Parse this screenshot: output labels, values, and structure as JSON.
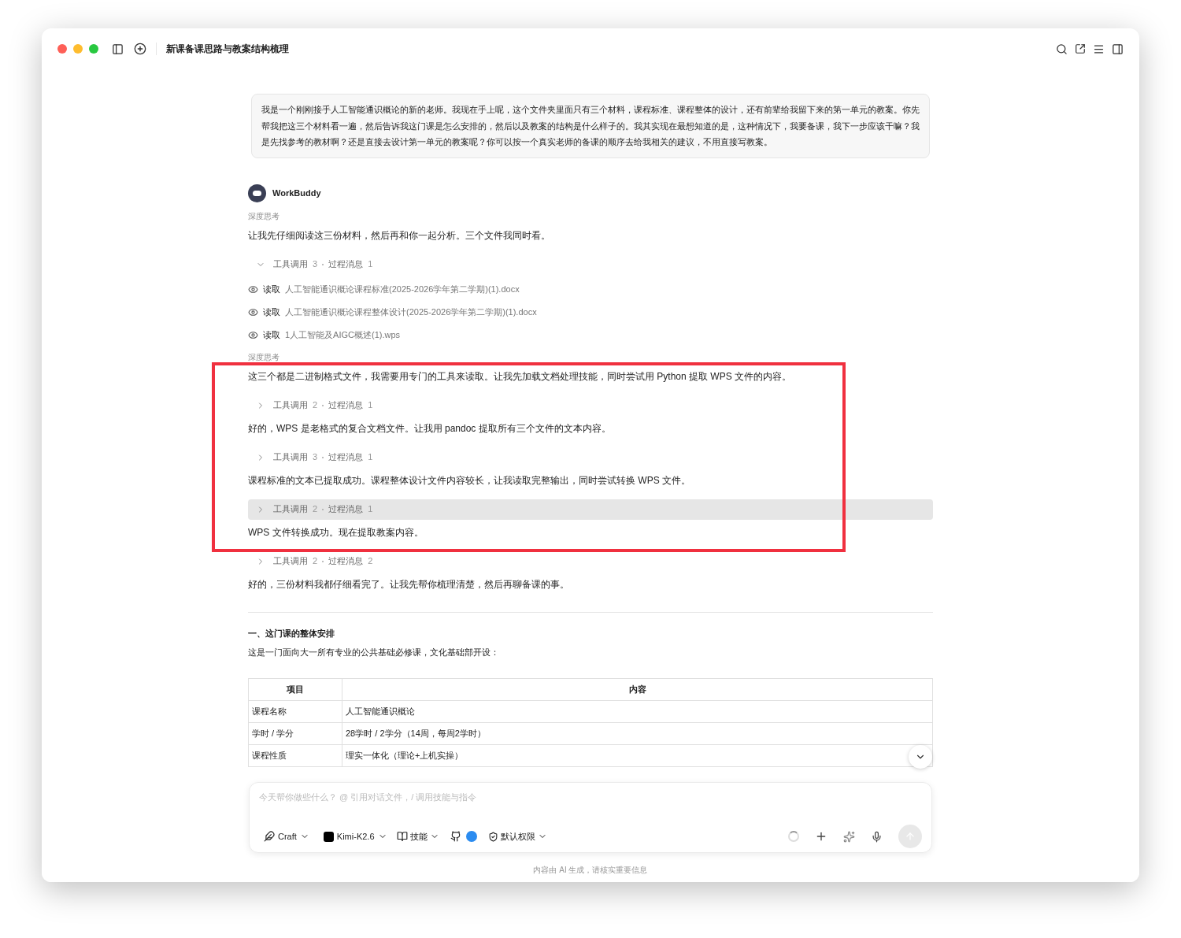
{
  "window": {
    "title": "新课备课思路与教案结构梳理"
  },
  "user_message": {
    "text": "我是一个刚刚接手人工智能通识概论的新的老师。我现在手上呢，这个文件夹里面只有三个材料，课程标准、课程整体的设计，还有前辈给我留下来的第一单元的教案。你先帮我把这三个材料看一遍，然后告诉我这门课是怎么安排的，然后以及教案的结构是什么样子的。我其实现在最想知道的是，这种情况下，我要备课，我下一步应该干嘛？我是先找参考的教材啊？还是直接去设计第一单元的教案呢？你可以按一个真实老师的备课的顺序去给我相关的建议，不用直接写教案。"
  },
  "assistant": {
    "name": "WorkBuddy",
    "blocks": [
      {
        "kind": "thinking",
        "text": "深度思考"
      },
      {
        "kind": "text",
        "text": "让我先仔细阅读这三份材料，然后再和你一起分析。三个文件我同时看。"
      },
      {
        "kind": "tools",
        "tools_label": "工具调用",
        "tools_count": "3",
        "process_label": "过程消息",
        "process_count": "1",
        "expanded": true,
        "highlighted": false
      },
      {
        "kind": "read",
        "action": "读取",
        "file": "人工智能通识概论课程标准(2025-2026学年第二学期)(1).docx"
      },
      {
        "kind": "read",
        "action": "读取",
        "file": "人工智能通识概论课程整体设计(2025-2026学年第二学期)(1).docx"
      },
      {
        "kind": "read",
        "action": "读取",
        "file": "1人工智能及AIGC概述(1).wps"
      },
      {
        "kind": "thinking",
        "text": "深度思考"
      },
      {
        "kind": "text",
        "text": "这三个都是二进制格式文件，我需要用专门的工具来读取。让我先加载文档处理技能，同时尝试用 Python 提取 WPS 文件的内容。"
      },
      {
        "kind": "tools",
        "tools_label": "工具调用",
        "tools_count": "2",
        "process_label": "过程消息",
        "process_count": "1",
        "expanded": false,
        "highlighted": false
      },
      {
        "kind": "text",
        "text": "好的，WPS 是老格式的复合文档文件。让我用 pandoc 提取所有三个文件的文本内容。"
      },
      {
        "kind": "tools",
        "tools_label": "工具调用",
        "tools_count": "3",
        "process_label": "过程消息",
        "process_count": "1",
        "expanded": false,
        "highlighted": false
      },
      {
        "kind": "text",
        "text": "课程标准的文本已提取成功。课程整体设计文件内容较长，让我读取完整输出，同时尝试转换 WPS 文件。"
      },
      {
        "kind": "tools",
        "tools_label": "工具调用",
        "tools_count": "2",
        "process_label": "过程消息",
        "process_count": "1",
        "expanded": false,
        "highlighted": true
      },
      {
        "kind": "text",
        "text": "WPS 文件转换成功。现在提取教案内容。"
      },
      {
        "kind": "tools",
        "tools_label": "工具调用",
        "tools_count": "2",
        "process_label": "过程消息",
        "process_count": "2",
        "expanded": false,
        "highlighted": false
      },
      {
        "kind": "text",
        "text": "好的，三份材料我都仔细看完了。让我先帮你梳理清楚，然后再聊备课的事。"
      }
    ]
  },
  "section": {
    "heading": "一、这门课的整体安排",
    "intro": "这是一门面向大一所有专业的公共基础必修课，文化基础部开设："
  },
  "table": {
    "columns": [
      "项目",
      "内容"
    ],
    "rows": [
      [
        "课程名称",
        "人工智能通识概论"
      ],
      [
        "学时 / 学分",
        "28学时 / 2学分（14周，每周2学时）"
      ],
      [
        "课程性质",
        "理实一体化（理论+上机实操）"
      ]
    ]
  },
  "composer": {
    "placeholder": "今天帮你做些什么？ @ 引用对话文件，/ 调用技能与指令",
    "mode": "Craft",
    "model": "Kimi-K2.6",
    "skills": "技能",
    "permission": "默认权限"
  },
  "footer": {
    "disclaimer": "内容由 AI 生成，请核实重要信息"
  }
}
